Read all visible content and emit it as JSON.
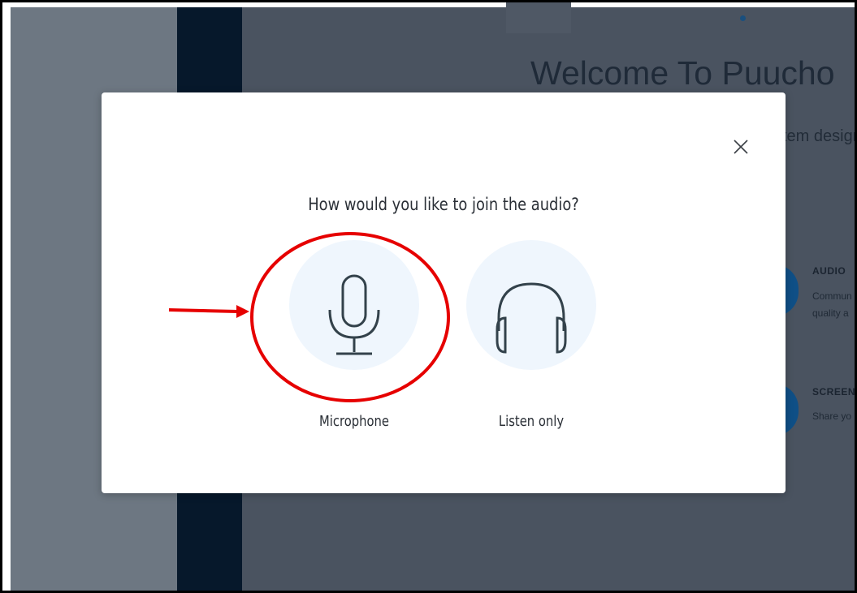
{
  "background_page": {
    "welcome_title": "Welcome To Puucho",
    "subtitle_fragment": "tem design",
    "features": [
      {
        "title": "AUDIO",
        "line1": "Commun",
        "line2": "quality a"
      },
      {
        "title": "SCREEN",
        "line1": "Share yo"
      }
    ]
  },
  "modal": {
    "question": "How would you like to join the audio?",
    "close_icon": "close-icon",
    "options": [
      {
        "label": "Microphone",
        "icon": "microphone-icon"
      },
      {
        "label": "Listen only",
        "icon": "headphones-icon"
      }
    ]
  },
  "colors": {
    "overlay": "#4a5360",
    "sidebar": "#06182b",
    "option_bg": "#eff6fd",
    "icon_stroke": "#33424b",
    "annotation": "#e60000",
    "feature_accent": "#0f4f86"
  },
  "annotation": {
    "highlighted_option": "Microphone",
    "shapes": [
      "red-circle",
      "red-arrow"
    ]
  }
}
